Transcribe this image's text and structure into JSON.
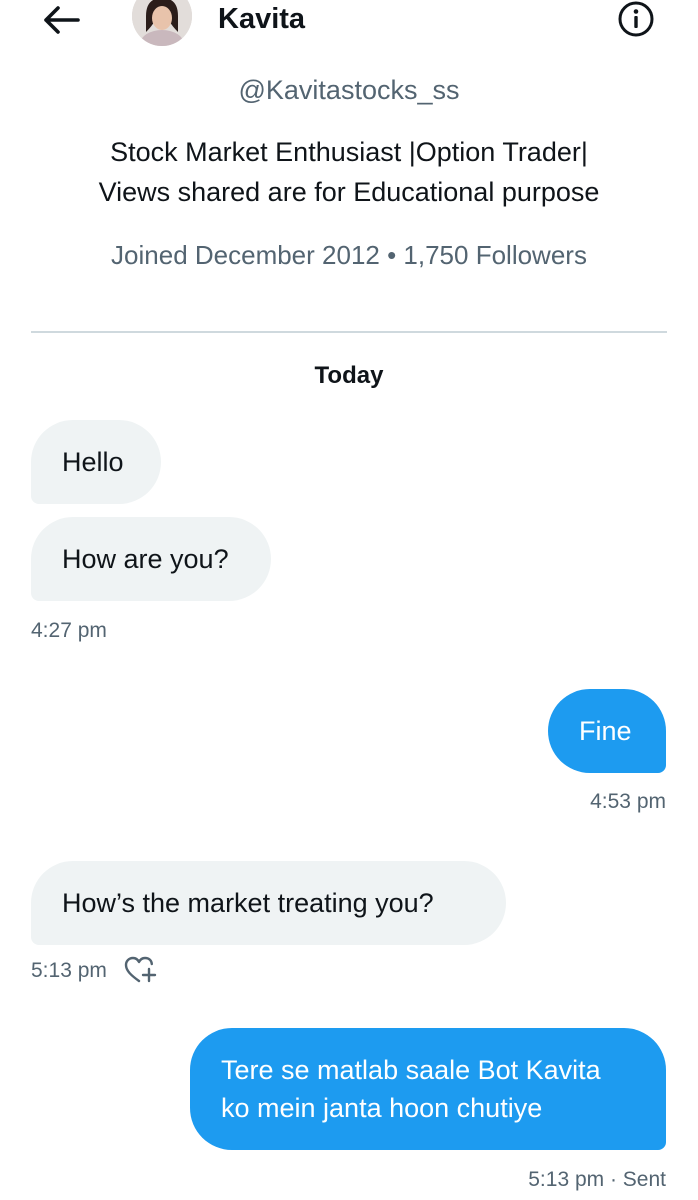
{
  "header": {
    "name": "Kavita",
    "icons": {
      "back": "arrow-left-icon",
      "info": "info-circle-icon"
    }
  },
  "profile": {
    "handle": "@Kavitastocks_ss",
    "bio_line1": "Stock Market Enthusiast |Option Trader|",
    "bio_line2": "Views shared are for Educational purpose",
    "meta": "Joined December 2012 • 1,750 Followers"
  },
  "conversation": {
    "date_label": "Today",
    "messages": [
      {
        "direction": "received",
        "text": "Hello"
      },
      {
        "direction": "received",
        "text": "How are you?",
        "time": "4:27 pm"
      },
      {
        "direction": "sent",
        "text": "Fine",
        "time": "4:53 pm"
      },
      {
        "direction": "received",
        "text": "How’s the market treating you?",
        "time": "5:13 pm",
        "reaction_icon": "heart-plus-icon"
      },
      {
        "direction": "sent",
        "lines": [
          "Tere se matlab saale Bot Kavita",
          "ko mein janta hoon chutiye"
        ],
        "time": "5:13 pm · Sent"
      }
    ]
  },
  "colors": {
    "accent": "#1d9bf0",
    "received_bubble": "#eff3f4",
    "secondary_text": "#536471",
    "divider": "#cfd9de"
  }
}
